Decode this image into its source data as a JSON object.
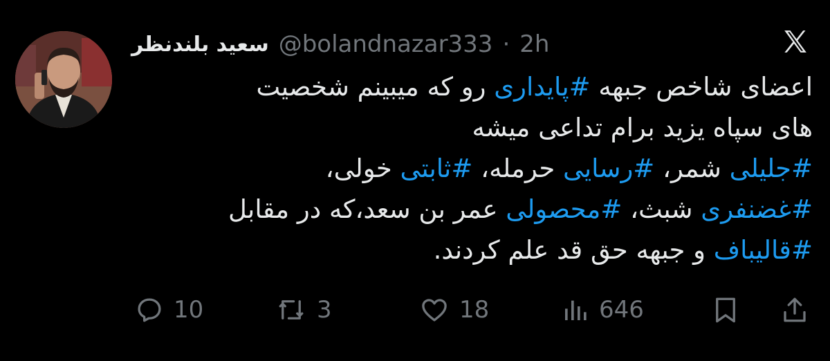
{
  "author": {
    "display_name": "سعید بلندنظر",
    "handle": "@bolandnazar333",
    "separator": "·",
    "time": "2h"
  },
  "body": {
    "lines": [
      [
        {
          "text": "اعضای شاخص جبهه ",
          "tag": false
        },
        {
          "text": "#پایداری",
          "tag": true
        },
        {
          "text": " رو که میبینم شخصیت",
          "tag": false
        }
      ],
      [
        {
          "text": "های سپاه یزید برام تداعی میشه",
          "tag": false
        }
      ],
      [
        {
          "text": "#جلیلی",
          "tag": true
        },
        {
          "text": " شمر، ",
          "tag": false
        },
        {
          "text": "#رسایی",
          "tag": true
        },
        {
          "text": " حرمله، ",
          "tag": false
        },
        {
          "text": "#ثابتی",
          "tag": true
        },
        {
          "text": " خولی،",
          "tag": false
        }
      ],
      [
        {
          "text": "#غضنفری",
          "tag": true
        },
        {
          "text": " شبث، ",
          "tag": false
        },
        {
          "text": "#محصولی",
          "tag": true
        },
        {
          "text": " عمر بن سعد،که در مقابل",
          "tag": false
        }
      ],
      [
        {
          "text": "#قالیباف",
          "tag": true
        },
        {
          "text": " و جبهه حق قد علم کردند.",
          "tag": false
        }
      ]
    ]
  },
  "actions": {
    "replies": "10",
    "reposts": "3",
    "likes": "18",
    "views": "646"
  },
  "icons": {
    "logo": "x-logo-icon",
    "reply": "reply-icon",
    "repost": "repost-icon",
    "like": "heart-icon",
    "views": "views-icon",
    "bookmark": "bookmark-icon",
    "share": "share-icon"
  },
  "colors": {
    "background": "#000000",
    "text": "#e7e9ea",
    "secondary": "#71767b",
    "hashtag": "#1d9bf0"
  }
}
